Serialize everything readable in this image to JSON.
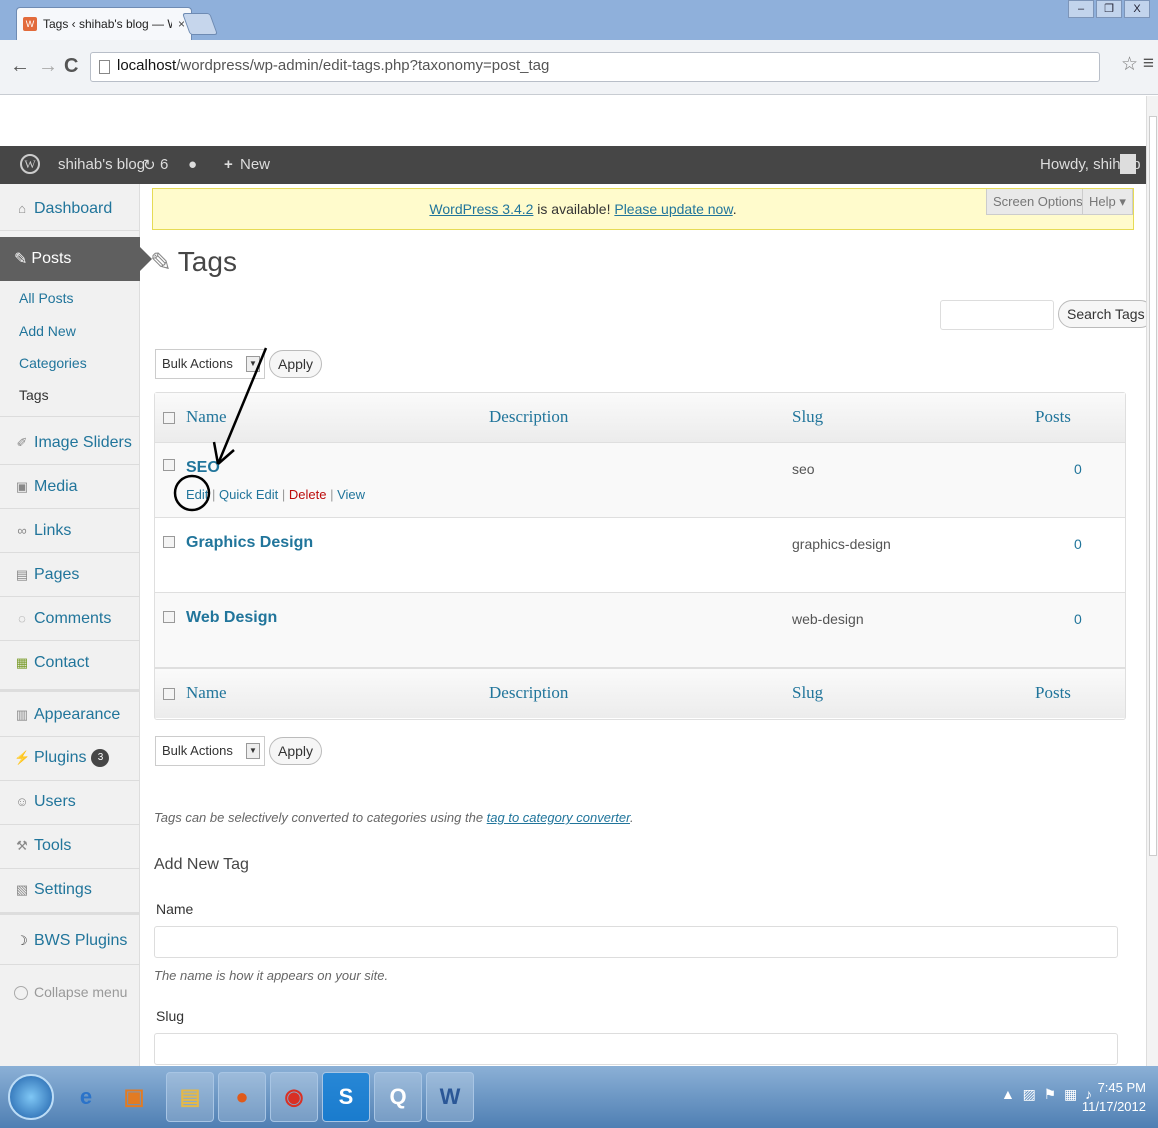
{
  "browser": {
    "tab_title": "Tags ‹ shihab's blog — W",
    "tab_close": "×",
    "url_host": "localhost",
    "url_path": "/wordpress/wp-admin/edit-tags.php?taxonomy=post_tag",
    "back": "←",
    "forward": "→",
    "reload": "C",
    "star": "☆",
    "menu": "≡"
  },
  "adminbar": {
    "site": "shihab's blog",
    "updates": "6",
    "new": "New",
    "howdy": "Howdy, shihiab"
  },
  "sidebar": {
    "dashboard": "Dashboard",
    "posts": "Posts",
    "submenu": [
      "All Posts",
      "Add New",
      "Categories",
      "Tags"
    ],
    "image_sliders": "Image Sliders",
    "media": "Media",
    "links": "Links",
    "pages": "Pages",
    "comments": "Comments",
    "contact": "Contact",
    "appearance": "Appearance",
    "plugins": "Plugins",
    "plugins_badge": "3",
    "users": "Users",
    "tools": "Tools",
    "settings": "Settings",
    "bws_plugins": "BWS Plugins",
    "collapse": "Collapse menu"
  },
  "notice": {
    "version_link": "WordPress 3.4.2",
    "middle": " is available! ",
    "update_link": "Please update now",
    "end": "."
  },
  "screen_options": "Screen Options ▾",
  "help": "Help ▾",
  "page_title": "Tags",
  "search_button": "Search Tags",
  "bulk": {
    "label": "Bulk Actions",
    "apply": "Apply"
  },
  "table": {
    "columns": [
      "Name",
      "Description",
      "Slug",
      "Posts"
    ],
    "rows": [
      {
        "name": "SEO",
        "slug": "seo",
        "posts": "0"
      },
      {
        "name": "Graphics Design",
        "slug": "graphics-design",
        "posts": "0"
      },
      {
        "name": "Web Design",
        "slug": "web-design",
        "posts": "0"
      }
    ],
    "row_actions": {
      "edit": "Edit",
      "quick_edit": "Quick Edit",
      "delete": "Delete",
      "view": "View",
      "sep": " | "
    }
  },
  "note": {
    "text": "Tags can be selectively converted to categories using the ",
    "link": "tag to category converter",
    "end": "."
  },
  "add_new": {
    "heading": "Add New Tag",
    "name_label": "Name",
    "name_help": "The name is how it appears on your site.",
    "slug_label": "Slug"
  },
  "taskbar": {
    "time": "7:45 PM",
    "date": "11/17/2012"
  }
}
